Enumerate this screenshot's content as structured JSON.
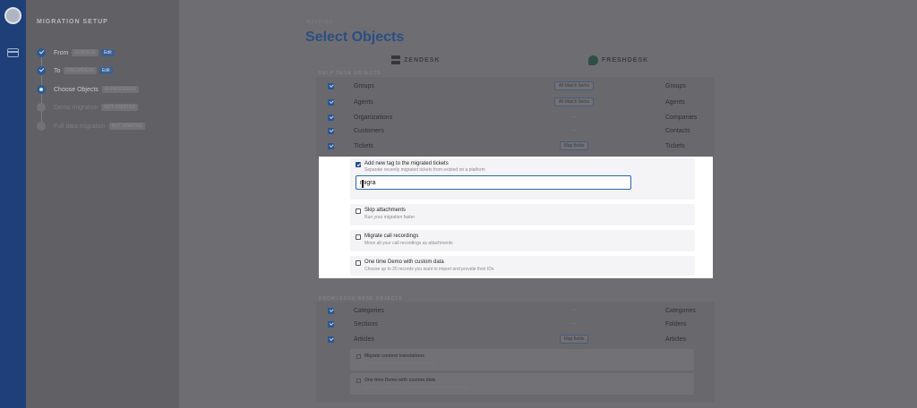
{
  "sidebar": {
    "heading": "MIGRATION SETUP",
    "steps": [
      {
        "label": "From",
        "pill": "ZENDESK",
        "tag": "Edit"
      },
      {
        "label": "To",
        "pill": "FRESHDESK",
        "tag": "Edit"
      },
      {
        "label": "Choose Objects",
        "pill": "IN PROGRESS"
      },
      {
        "label": "Demo migration",
        "pill": "NOT STARTED"
      },
      {
        "label": "Full data migration",
        "pill": "NOT STARTED"
      }
    ]
  },
  "main": {
    "eyebrow": "MAPPING",
    "title": "Select Objects",
    "source": "ZENDESK",
    "target": "FRESHDESK",
    "help_desk_heading": "HELP DESK OBJECTS",
    "knowledge_heading": "KNOWLEDGE BASE OBJECTS",
    "help_rows": [
      {
        "name": "Groups",
        "action": "All Match Items",
        "target": "Groups"
      },
      {
        "name": "Agents",
        "action": "All Match Items",
        "target": "Agents"
      },
      {
        "name": "Organizations",
        "action": "—",
        "target": "Companies"
      },
      {
        "name": "Customers",
        "action": "—",
        "target": "Contacts"
      },
      {
        "name": "Tickets",
        "action": "Map fields",
        "target": "Tickets"
      }
    ],
    "kb_rows": [
      {
        "name": "Categories",
        "action": "—",
        "target": "Categories"
      },
      {
        "name": "Sections",
        "action": "—",
        "target": "Folders"
      },
      {
        "name": "Articles",
        "action": "Map fields",
        "target": "Articles"
      }
    ]
  },
  "ticket_options": {
    "add_tag_title": "Add new tag to the migrated tickets",
    "add_tag_sub": "Separate recently migrated tickets from existed on a platform",
    "tag_value": "migra",
    "skip_title": "Skip attachments",
    "skip_sub": "Run your migration faster",
    "calls_title": "Migrate call recordings",
    "calls_sub": "Move all your call recordings as attachments",
    "demo_title": "One time Demo with custom data",
    "demo_sub": "Choose up to 20 records you want to import and provide their IDs"
  },
  "article_options": {
    "translations_title": "Migrate content translations",
    "translations_sub": "Import language versions of your KB articles",
    "demo_title": "One time Demo with custom data",
    "demo_sub": "Choose up to 20 records you want to import and provide their IDs"
  }
}
